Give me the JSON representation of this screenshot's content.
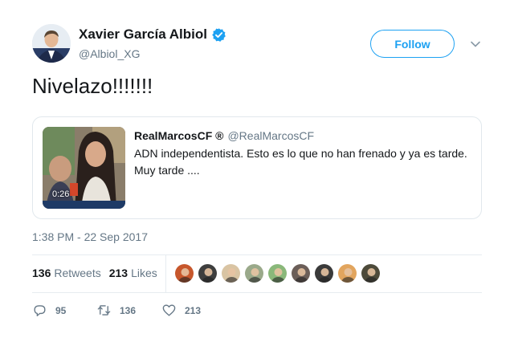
{
  "author": {
    "display_name": "Xavier García Albiol",
    "handle": "@Albiol_XG",
    "verified": true
  },
  "follow_label": "Follow",
  "tweet_text": "Nivelazo!!!!!!!",
  "quoted_tweet": {
    "display_name": "RealMarcosCF ®",
    "handle": "@RealMarcosCF",
    "text": "ADN independentista. Esto es lo que no han frenado y ya es tarde. Muy tarde ....",
    "video_duration": "0:26"
  },
  "timestamp": "1:38 PM - 22 Sep 2017",
  "stats": {
    "retweets_count": "136",
    "retweets_label": "Retweets",
    "likes_count": "213",
    "likes_label": "Likes"
  },
  "actions": {
    "reply_count": "95",
    "retweet_count": "136",
    "like_count": "213"
  },
  "colors": {
    "accent": "#1da1f2",
    "secondary_text": "#657786",
    "border": "#e1e8ed"
  },
  "likers": [
    {
      "name": "liker-1",
      "color": "#c7572c"
    },
    {
      "name": "liker-2",
      "color": "#3e3e3e"
    },
    {
      "name": "liker-3",
      "color": "#d9c4a3"
    },
    {
      "name": "liker-4",
      "color": "#9aa98a"
    },
    {
      "name": "liker-5",
      "color": "#8ab87a"
    },
    {
      "name": "liker-6",
      "color": "#6b5e58"
    },
    {
      "name": "liker-7",
      "color": "#3a3a3a"
    },
    {
      "name": "liker-8",
      "color": "#e2a55e"
    },
    {
      "name": "liker-9",
      "color": "#4d4a3a"
    }
  ]
}
